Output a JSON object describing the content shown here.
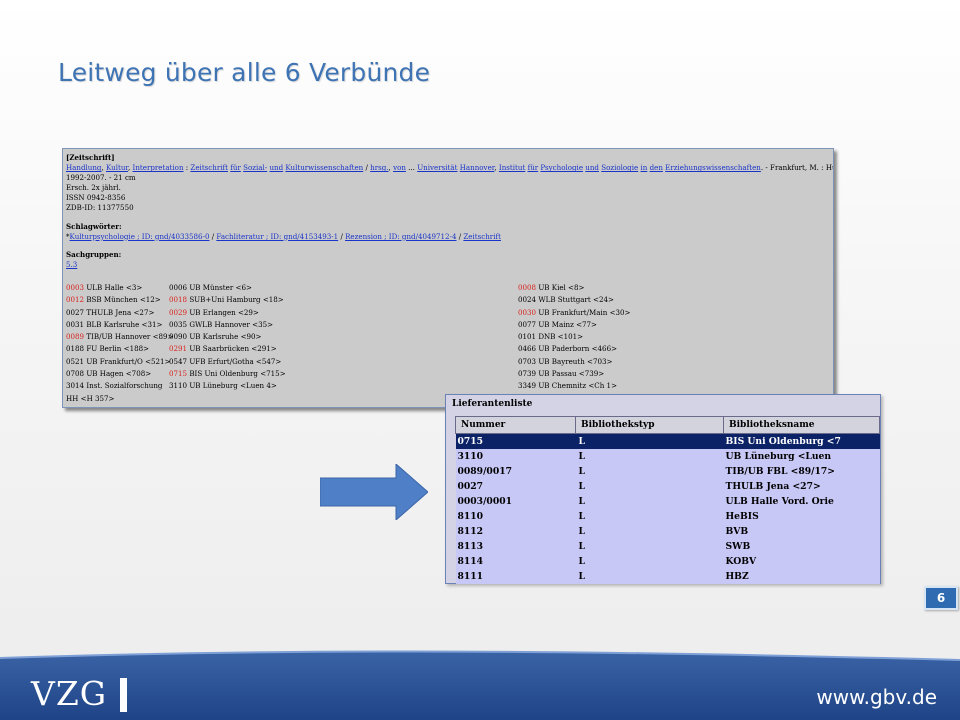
{
  "slide": {
    "title": "Leitweg über alle 6 Verbünde",
    "page_number": "6",
    "logo_text": "VZG",
    "url": "www.gbv.de",
    "brand_color": "#3f74b4"
  },
  "record": {
    "type_label": "[Zeitschrift]",
    "title_links": [
      "Handlung",
      "Kultur",
      "Interpretation",
      "Zeitschrift",
      "für",
      "Sozial-",
      "und",
      "Kulturwissenschaften",
      "hrsg.",
      "von",
      "Universität",
      "Hannover",
      "Institut",
      "für",
      "Psychologie",
      "und",
      "Soziologie",
      "in",
      "den",
      "Erziehungswissenschaften"
    ],
    "publisher_tail": " - Frankfurt, M. : Humanities Online,",
    "lines": [
      "1992-2007. - 21 cm",
      "Ersch. 2x jährl.",
      "ISSN 0942-8356",
      "ZDB-ID: 11377550"
    ],
    "subjects_label": "Schlagwörter:",
    "subject_links": [
      "Kulturpsychologie ; ID: gnd/4033586-0",
      "Fachliteratur ; ID: gnd/4153493-1",
      "Rezension ; ID: gnd/4049712-4",
      "Zeitschrift"
    ],
    "groups_label": "Sachgruppen:",
    "group_link": "5.3",
    "libraries": [
      [
        {
          "code": "0003",
          "name": " ULB Halle <3>",
          "red": true
        },
        {
          "code": "0006",
          "name": " UB Münster <6>",
          "red": false
        },
        {
          "code": "0008",
          "name": " UB Kiel <8>",
          "red": true
        }
      ],
      [
        {
          "code": "0012",
          "name": " BSB München <12>",
          "red": true
        },
        {
          "code": "0018",
          "name": " SUB+Uni Hamburg <18>",
          "red": true
        },
        {
          "code": "0024",
          "name": " WLB Stuttgart <24>",
          "red": false
        }
      ],
      [
        {
          "code": "0027",
          "name": " THULB Jena <27>",
          "red": false
        },
        {
          "code": "0029",
          "name": " UB Erlangen <29>",
          "red": true
        },
        {
          "code": "0030",
          "name": " UB Frankfurt/Main <30>",
          "red": true
        }
      ],
      [
        {
          "code": "0031",
          "name": " BLB Karlsruhe <31>",
          "red": false
        },
        {
          "code": "0035",
          "name": " GWLB Hannover <35>",
          "red": false
        },
        {
          "code": "0077",
          "name": " UB Mainz <77>",
          "red": false
        }
      ],
      [
        {
          "code": "0089",
          "name": " TIB/UB Hannover <89>",
          "red": true
        },
        {
          "code": "0090",
          "name": " UB Karlsruhe <90>",
          "red": false
        },
        {
          "code": "0101",
          "name": " DNB <101>",
          "red": false
        }
      ],
      [
        {
          "code": "0188",
          "name": " FU Berlin <188>",
          "red": false
        },
        {
          "code": "0291",
          "name": " UB Saarbrücken <291>",
          "red": true
        },
        {
          "code": "0466",
          "name": " UB Paderborn <466>",
          "red": false
        }
      ],
      [
        {
          "code": "0521",
          "name": " UB Frankfurt/O <521>",
          "red": false
        },
        {
          "code": "0547",
          "name": " UFB Erfurt/Gotha <547>",
          "red": false
        },
        {
          "code": "0703",
          "name": " UB Bayreuth <703>",
          "red": false
        }
      ],
      [
        {
          "code": "0708",
          "name": " UB Hagen <708>",
          "red": false
        },
        {
          "code": "0715",
          "name": " BIS Uni Oldenburg <715>",
          "red": true
        },
        {
          "code": "0739",
          "name": " UB Passau <739>",
          "red": false
        }
      ],
      [
        {
          "code": "3014",
          "name": " Inst. Sozialforschung",
          "red": false
        },
        {
          "code": "3110",
          "name": " UB Lüneburg <Luen 4>",
          "red": false
        },
        {
          "code": "3349",
          "name": " UB Chemnitz <Ch 1>",
          "red": false
        }
      ],
      [
        {
          "code": "HH",
          "name": " <H 357>",
          "red": false
        },
        {
          "code": "",
          "name": "",
          "red": false
        },
        {
          "code": "",
          "name": "",
          "red": false
        }
      ]
    ]
  },
  "supplier_list": {
    "title": "Lieferantenliste",
    "columns": [
      "Nummer",
      "Bibliothekstyp",
      "Bibliotheksname"
    ],
    "selected_index": 0,
    "rows": [
      [
        "0715",
        "L",
        "BIS Uni Oldenburg <7"
      ],
      [
        "3110",
        "L",
        "UB Lüneburg <Luen"
      ],
      [
        "0089/0017",
        "L",
        "TIB/UB FBL <89/17>"
      ],
      [
        "0027",
        "L",
        "THULB Jena <27>"
      ],
      [
        "0003/0001",
        "L",
        "ULB Halle Vord. Orie"
      ],
      [
        "8110",
        "L",
        "HeBIS"
      ],
      [
        "8112",
        "L",
        "BVB"
      ],
      [
        "8113",
        "L",
        "SWB"
      ],
      [
        "8114",
        "L",
        "KOBV"
      ],
      [
        "8111",
        "L",
        "HBZ"
      ]
    ]
  }
}
